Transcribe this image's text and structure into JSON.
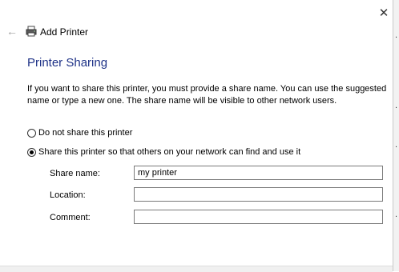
{
  "header": {
    "title": "Add Printer",
    "back_icon": "arrow-left-icon",
    "printer_icon": "printer-icon",
    "close_symbol": "✕"
  },
  "page": {
    "title": "Printer Sharing",
    "description": "If you want to share this printer, you must provide a share name. You can use the suggested name or type a new one. The share name will be visible to other network users."
  },
  "options": {
    "no_share": {
      "label": "Do not share this printer",
      "checked": false
    },
    "share": {
      "label": "Share this printer so that others on your network can find and use it",
      "checked": true
    }
  },
  "fields": {
    "share_name": {
      "label": "Share name:",
      "value": "my printer"
    },
    "location": {
      "label": "Location:",
      "value": ""
    },
    "comment": {
      "label": "Comment:",
      "value": ""
    }
  },
  "colors": {
    "title_blue": "#1e3287",
    "input_border": "#7a7a7a"
  }
}
